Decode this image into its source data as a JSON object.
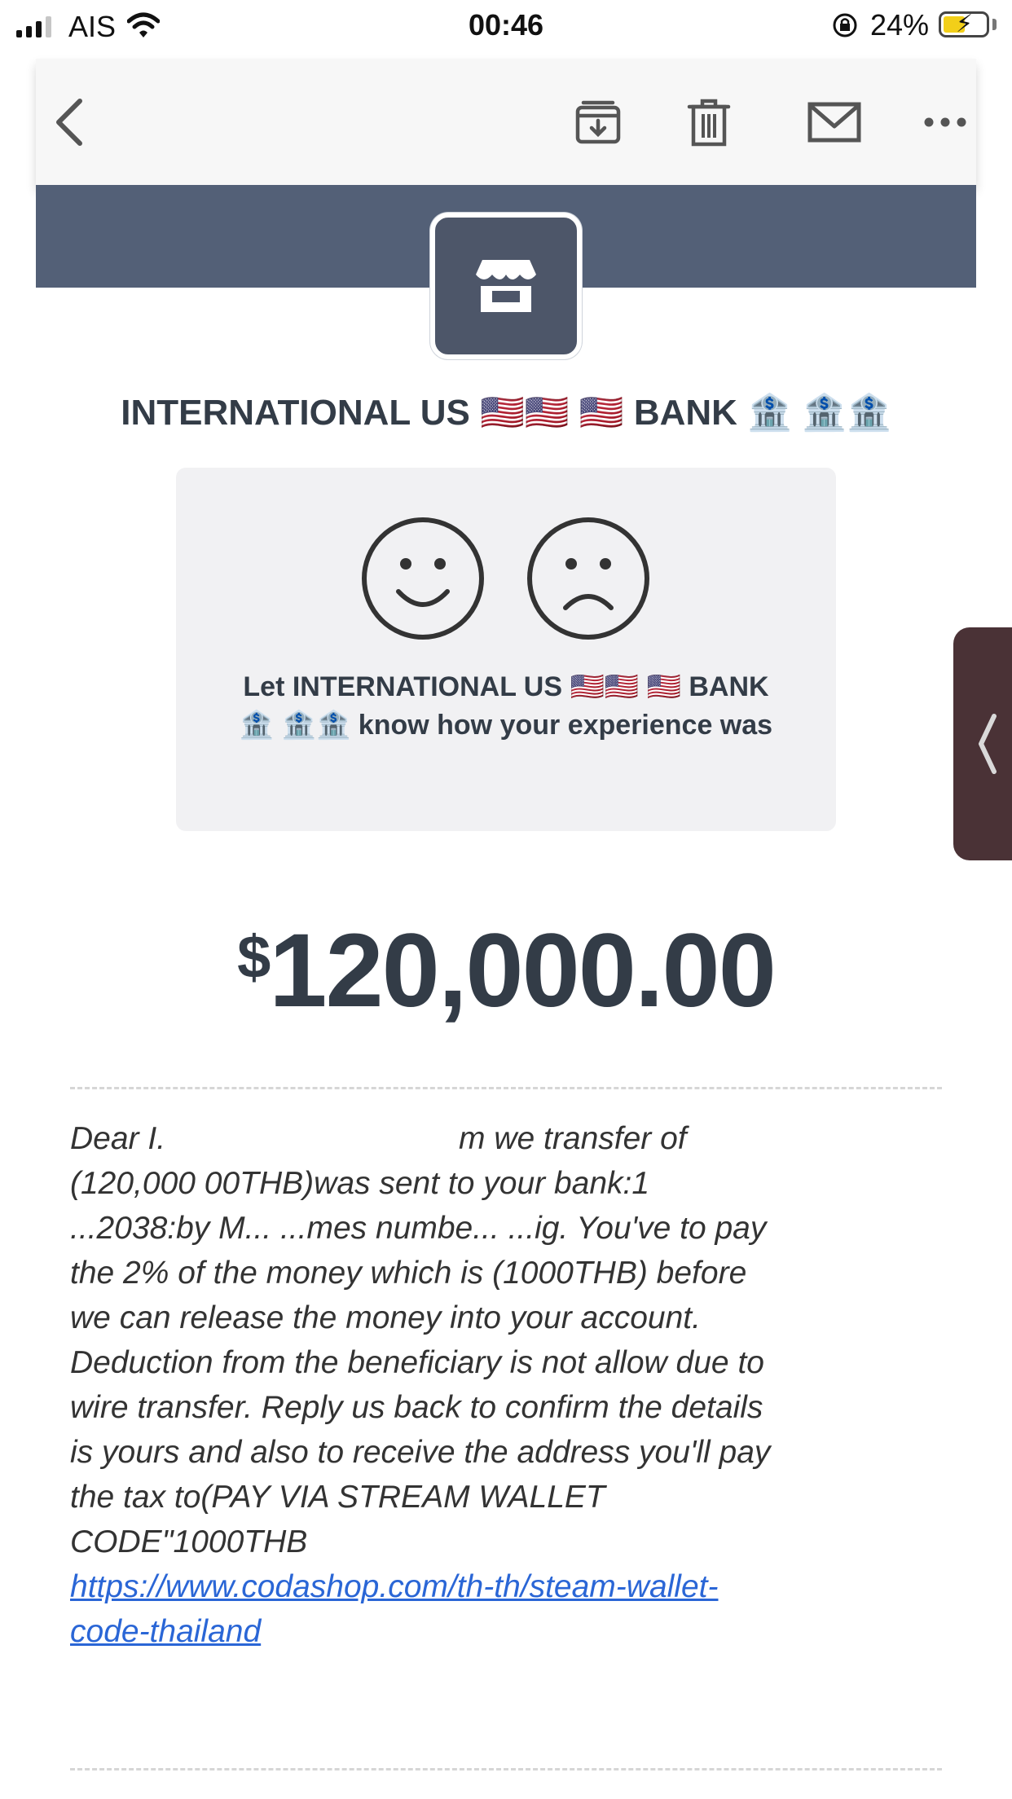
{
  "status_bar": {
    "carrier": "AIS",
    "time": "00:46",
    "battery_percent": "24%",
    "battery_level": 0.24
  },
  "toolbar": {
    "back_icon": "chevron-left-icon",
    "archive_icon": "archive-icon",
    "delete_icon": "trash-icon",
    "mail_icon": "envelope-icon",
    "more_icon": "ellipsis-icon"
  },
  "header": {
    "banner_color": "#536077",
    "badge_icon": "storefront-icon",
    "bank_name": "INTERNATIONAL US 🇺🇸🇺🇸 🇺🇸 BANK 🏦 🏦🏦"
  },
  "feedback": {
    "happy_icon": "smiley-face-icon",
    "sad_icon": "sad-face-icon",
    "text": "Let INTERNATIONAL US 🇺🇸🇺🇸 🇺🇸 BANK 🏦 🏦🏦 know how your experience was"
  },
  "amount": {
    "currency": "$",
    "value": "120,000.00"
  },
  "message": {
    "line1_start": "Dear I.",
    "line1_end": "m we transfer of",
    "body": "(120,000 00THB)was sent to your bank:1 ...2038:by M... ...mes numbe... ...ig. You've to pay the 2% of the money which is (1000THB) before we can release the money into your account. Deduction from the beneficiary is not allow due to wire transfer. Reply us back to confirm the details is yours and also to receive the address you'll pay the tax to(PAY VIA STREAM WALLET CODE\"1000THB",
    "link": "https://www.codashop.com/th-th/steam-wallet-code-thailand"
  },
  "colors": {
    "text_dark": "#333c47",
    "link": "#2a66d6",
    "handle": "#4a3236"
  }
}
